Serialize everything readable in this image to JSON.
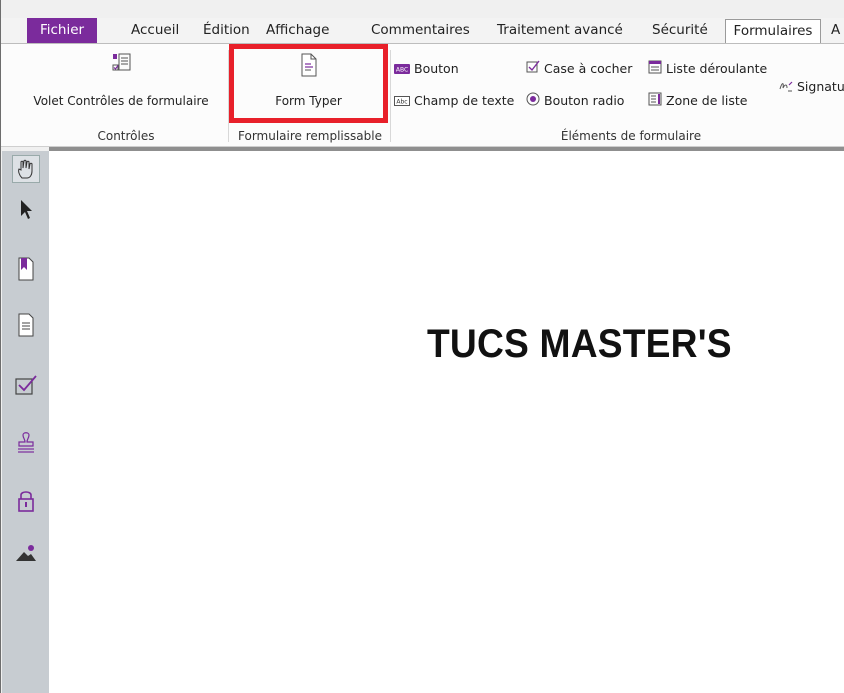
{
  "menu": {
    "file": "Fichier",
    "items": [
      "Accueil",
      "Édition",
      "Affichage",
      "Commentaires",
      "Traitement avancé",
      "Sécurité",
      "Formulaires",
      "A"
    ],
    "active": "Formulaires"
  },
  "ribbon": {
    "controls": {
      "volet_label": "Volet Contrôles de formulaire",
      "group_label": "Contrôles"
    },
    "fillable": {
      "form_typer_label": "Form Typer",
      "group_label": "Formulaire remplissable"
    },
    "elements": {
      "bouton": "Bouton",
      "champ_texte": "Champ de texte",
      "case_cocher": "Case à cocher",
      "bouton_radio": "Bouton radio",
      "liste_deroulante": "Liste déroulante",
      "zone_liste": "Zone de liste",
      "signature": "Signatu",
      "group_label": "Éléments de formulaire"
    }
  },
  "left_toolbar": [
    "hand-tool-icon",
    "select-arrow-icon",
    "bookmark-icon",
    "page-icon",
    "checkbox-icon",
    "stamp-icon",
    "lock-icon",
    "image-icon"
  ],
  "document": {
    "title": "TUCS MASTER'S"
  },
  "colors": {
    "accent": "#7b2b9c",
    "highlight": "#e8202a",
    "toolbar": "#c7ccd1"
  }
}
